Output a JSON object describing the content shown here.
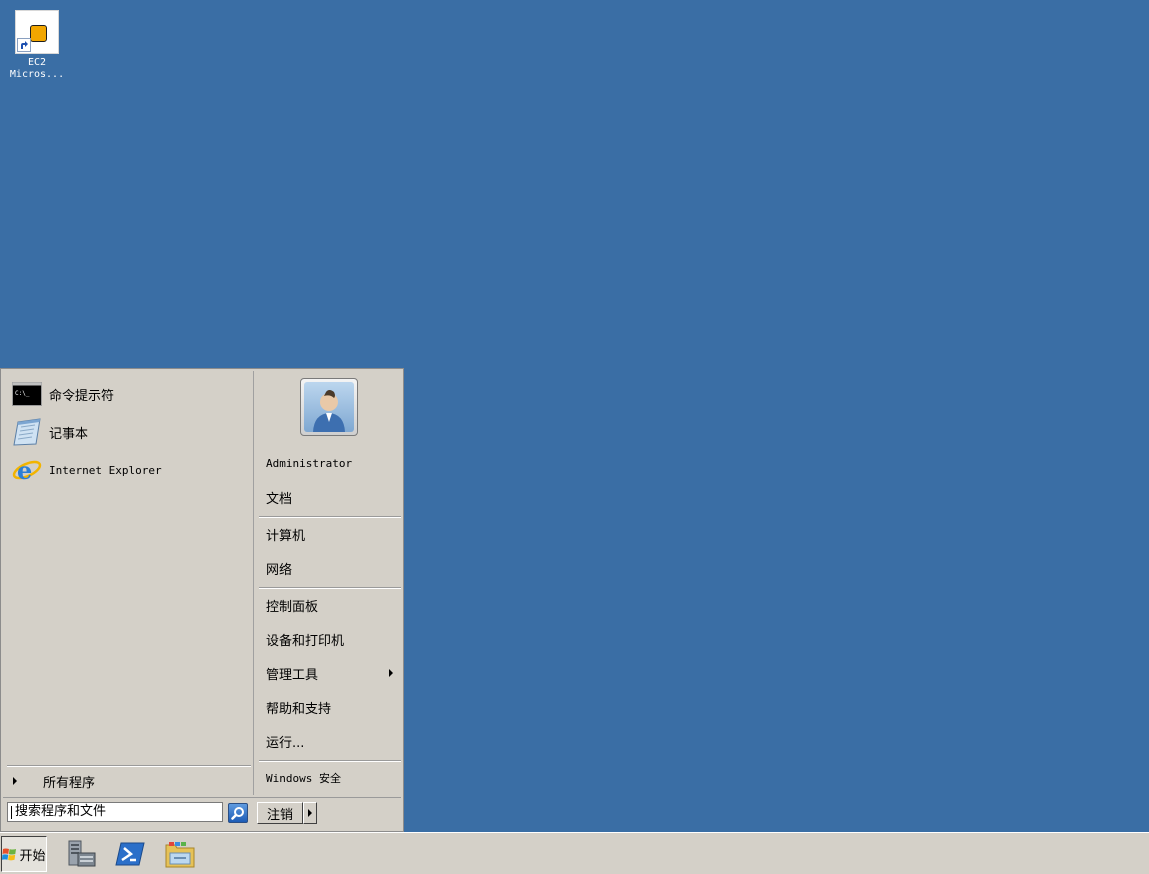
{
  "desktop": {
    "background": "#3a6ea5",
    "icons": [
      {
        "label_line1": "EC2",
        "label_line2": "Micros...",
        "icon": "ec2-shortcut-icon"
      }
    ]
  },
  "start_menu": {
    "pinned": [
      {
        "label": "命令提示符",
        "icon": "command-prompt-icon"
      },
      {
        "label": "记事本",
        "icon": "notepad-icon"
      },
      {
        "label": "Internet Explorer",
        "icon": "internet-explorer-icon"
      }
    ],
    "all_programs": "所有程序",
    "user_name": "Administrator",
    "right_items": [
      {
        "label": "文档"
      },
      {
        "label": "计算机"
      },
      {
        "label": "网络"
      },
      {
        "label": "控制面板"
      },
      {
        "label": "设备和打印机"
      },
      {
        "label": "管理工具"
      },
      {
        "label": "帮助和支持"
      },
      {
        "label": "运行..."
      },
      {
        "label": "Windows 安全"
      }
    ],
    "search_placeholder": "搜索程序和文件",
    "logoff": "注销"
  },
  "taskbar": {
    "start_label": "开始",
    "pinned": [
      {
        "icon": "server-manager-icon"
      },
      {
        "icon": "powershell-icon"
      },
      {
        "icon": "file-explorer-icon"
      }
    ]
  }
}
